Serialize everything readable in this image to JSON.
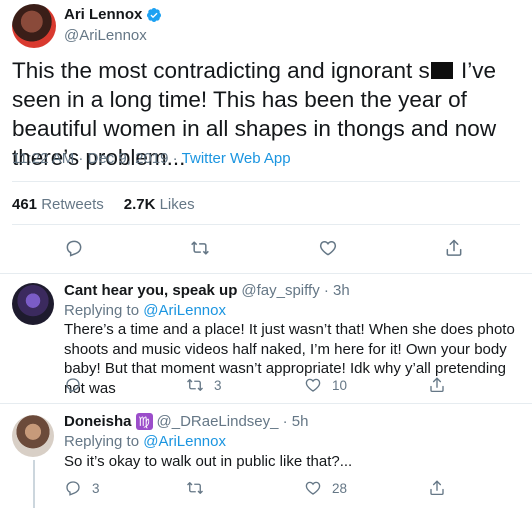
{
  "main_tweet": {
    "display_name": "Ari Lennox",
    "handle": "@AriLennox",
    "text_before": "This the most contradicting and ignorant s",
    "text_after": " I’ve seen in a long time! This has been the year of beautiful women in all shapes in thongs and now there’s problem...",
    "time": "11:22 AM · Dec 9, 2019 ·",
    "app": "Twitter Web App",
    "retweets_count": "461",
    "retweets_label": "Retweets",
    "likes_count": "2.7K",
    "likes_label": "Likes",
    "icons": [
      "reply-icon",
      "retweet-icon",
      "like-icon",
      "share-icon"
    ]
  },
  "replies": [
    {
      "display_name": "Cant hear you, speak up",
      "handle_time": "@fay_spiffy · 3h",
      "replying_prefix": "Replying to",
      "replying_to": "@AriLennox",
      "text": "There’s a time and a place! It just wasn’t that! When she does photo shoots and music videos half naked, I’m here for it! Own your body baby! But that moment wasn’t appropriate! Idk why y’all pretending not was",
      "reply_count": "",
      "retweet_count": "3",
      "like_count": "10"
    },
    {
      "display_name": "Doneisha",
      "zodiac": "♍",
      "handle_time": "@_DRaeLindsey_ · 5h",
      "replying_prefix": "Replying to",
      "replying_to": "@AriLennox",
      "text": "So it’s okay to walk out in public like that?...",
      "reply_count": "3",
      "retweet_count": "",
      "like_count": "28"
    }
  ],
  "colors": {
    "link": "#1b95e0",
    "secondary": "#657786",
    "verified": "#1da1f2"
  }
}
